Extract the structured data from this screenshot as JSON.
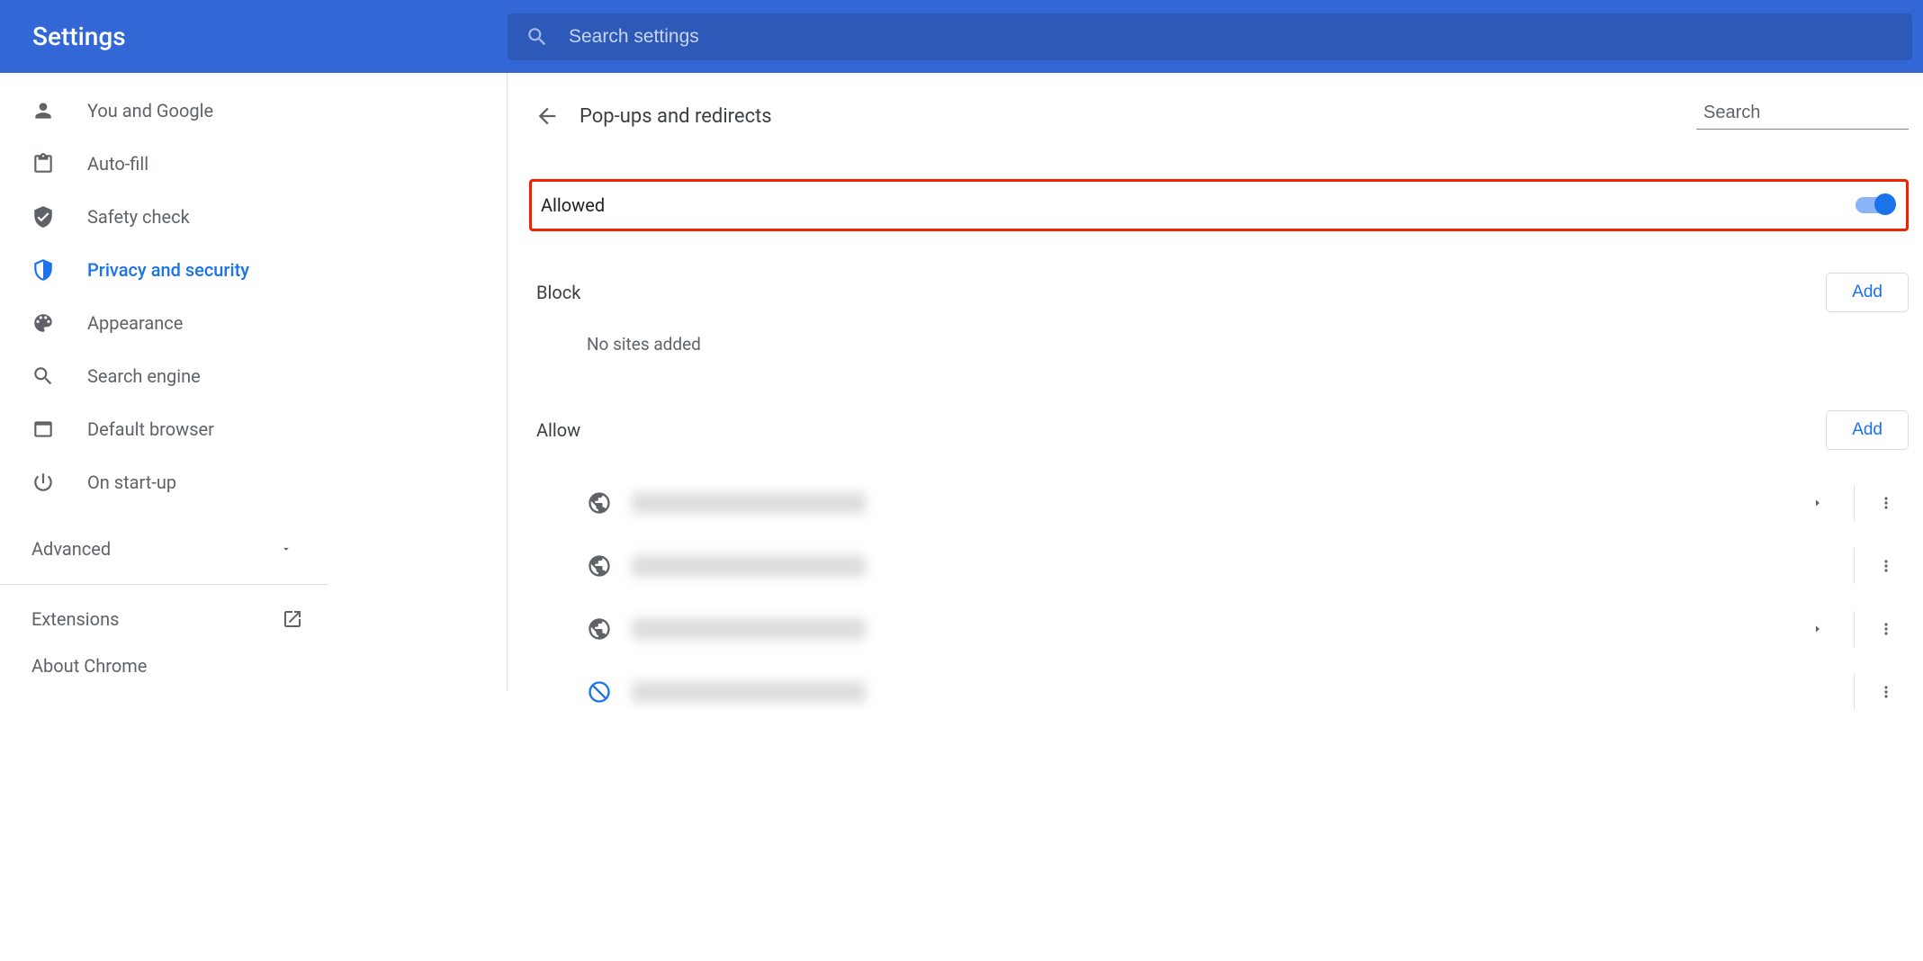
{
  "header": {
    "title": "Settings",
    "search_placeholder": "Search settings"
  },
  "sidebar": {
    "items": [
      {
        "label": "You and Google"
      },
      {
        "label": "Auto-fill"
      },
      {
        "label": "Safety check"
      },
      {
        "label": "Privacy and security"
      },
      {
        "label": "Appearance"
      },
      {
        "label": "Search engine"
      },
      {
        "label": "Default browser"
      },
      {
        "label": "On start-up"
      }
    ],
    "advanced_label": "Advanced",
    "extensions_label": "Extensions",
    "about_label": "About Chrome"
  },
  "page": {
    "title": "Pop-ups and redirects",
    "search_placeholder": "Search",
    "allowed_toggle_label": "Allowed",
    "block_section": {
      "label": "Block",
      "add_label": "Add",
      "empty_text": "No sites added"
    },
    "allow_section": {
      "label": "Allow",
      "add_label": "Add",
      "sites": [
        {
          "has_arrow": true,
          "icon": "globe"
        },
        {
          "has_arrow": false,
          "icon": "globe"
        },
        {
          "has_arrow": true,
          "icon": "globe"
        },
        {
          "has_arrow": false,
          "icon": "custom"
        }
      ]
    }
  }
}
